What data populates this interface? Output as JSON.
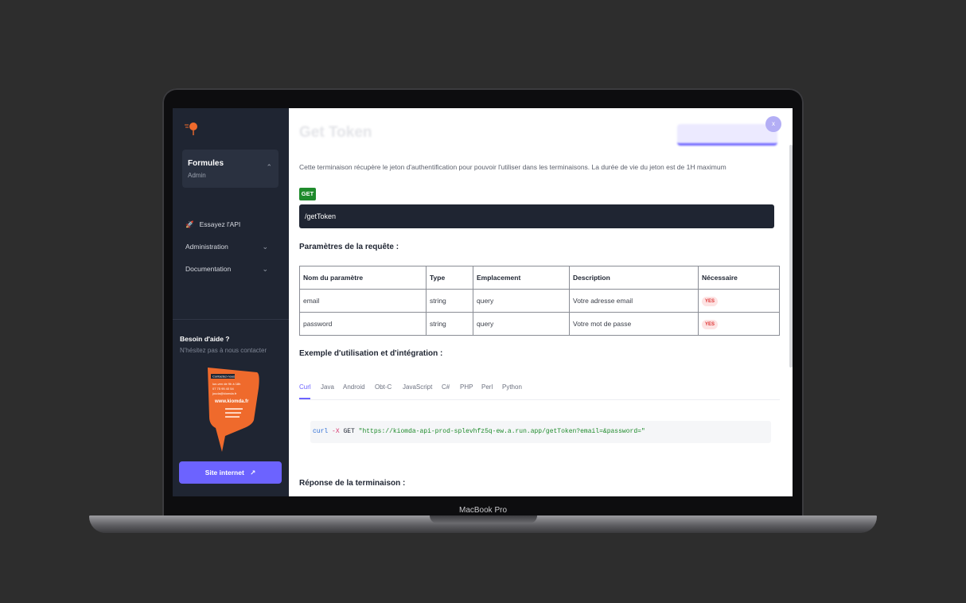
{
  "device": {
    "label": "MacBook Pro"
  },
  "sidebar": {
    "formules": {
      "title": "Formules",
      "subtitle": "Admin"
    },
    "nav": [
      {
        "label": "Essayez l'API",
        "icon": "rocket-icon"
      },
      {
        "label": "Administration",
        "icon": "chevron-down-icon"
      },
      {
        "label": "Documentation",
        "icon": "chevron-down-icon"
      }
    ],
    "help": {
      "title": "Besoin d'aide ?",
      "subtitle": "N'hésitez pas à nous contacter"
    },
    "promo": {
      "header": "Contactez-nous",
      "hours": "lun-ven de 9h à 18h",
      "phone": "07 75 95 40 54",
      "email": "jouda@kiomda.fr",
      "site": "www.kiomda.fr"
    },
    "site_button": "Site internet"
  },
  "main": {
    "title": "Get Token",
    "close_label": "x",
    "description": "Cette terminaison récupère le jeton d'authentification pour pouvoir l'utiliser dans les terminaisons. La durée de vie du jeton est de 1H maximum",
    "method": "GET",
    "endpoint": "/getToken",
    "params_heading": "Paramètres de la requête :",
    "table": {
      "headers": [
        "Nom du paramètre",
        "Type",
        "Emplacement",
        "Description",
        "Nécessaire"
      ],
      "rows": [
        [
          "email",
          "string",
          "query",
          "Votre adresse email",
          "YES"
        ],
        [
          "password",
          "string",
          "query",
          "Votre mot de passe",
          "YES"
        ]
      ]
    },
    "example_heading": "Exemple d'utilisation et d'intégration :",
    "tabs": [
      "Curl",
      "Java",
      "Android",
      "Obt-C",
      "JavaScript",
      "C#",
      "PHP",
      "Perl",
      "Python"
    ],
    "active_tab": "Curl",
    "code": {
      "cmd": "curl",
      "flag": "-X",
      "method": "GET",
      "url": "\"https://kiomda-api-prod-splevhfz5q-ew.a.run.app/getToken?email=&password=\""
    },
    "response_heading": "Réponse de la terminaison :"
  },
  "colors": {
    "accent": "#6c63ff",
    "sidebar_bg": "#1f2532",
    "get_green": "#1f8b2c",
    "promo_orange": "#ef6a2c"
  }
}
